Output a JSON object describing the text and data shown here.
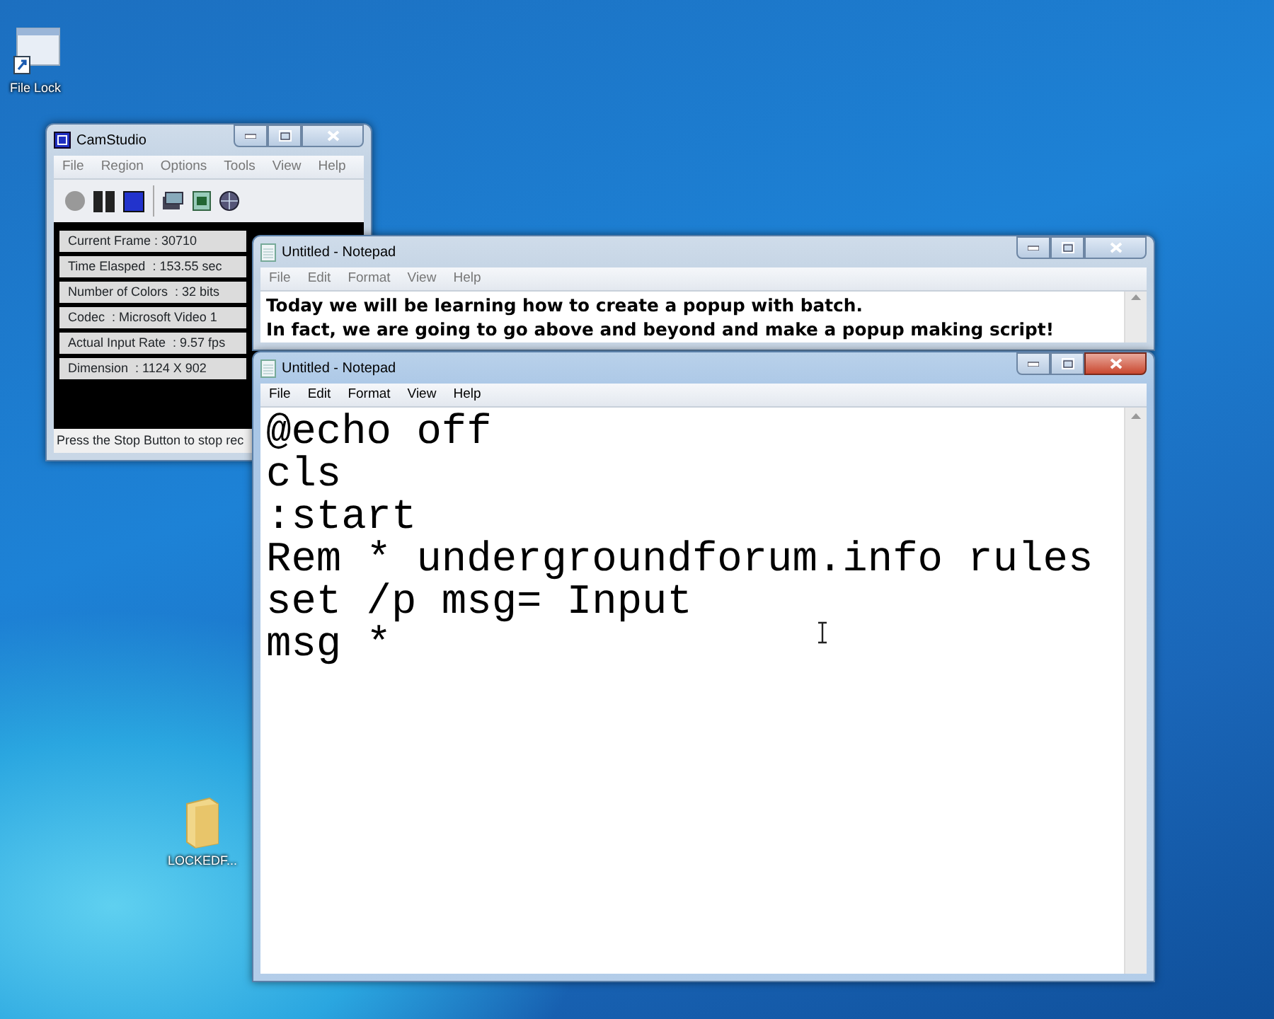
{
  "desktop_icons": [
    {
      "kind": "shortcut",
      "label": "File Lock"
    },
    {
      "kind": "folder",
      "label": "LOCKEDF..."
    }
  ],
  "windows": [
    {
      "kind": "camstudio",
      "title": "CamStudio",
      "active": false,
      "menu": [
        "File",
        "Region",
        "Options",
        "Tools",
        "View",
        "Help"
      ],
      "stats": [
        "Current Frame : 30710",
        "Time Elasped  : 153.55 sec",
        "Number of Colors  : 32 bits",
        "Codec  : Microsoft Video 1",
        "Actual Input Rate  : 9.57 fps",
        "Dimension  : 1124 X 902"
      ],
      "status_bar": "Press the Stop Button to stop rec"
    },
    {
      "kind": "notepad",
      "title": "Untitled - Notepad",
      "active": false,
      "menu": [
        "File",
        "Edit",
        "Format",
        "View",
        "Help"
      ],
      "lines": [
        "Today we will be learning how to create a popup with batch.",
        "In fact, we are going to go above and beyond and make a popup making script!"
      ]
    },
    {
      "kind": "notepad",
      "title": "Untitled - Notepad",
      "active": true,
      "menu": [
        "File",
        "Edit",
        "Format",
        "View",
        "Help"
      ],
      "lines": [
        "@echo off",
        "cls",
        ":start",
        "Rem * undergroundforum.info rules",
        "set /p msg= Input",
        "msg *"
      ]
    }
  ]
}
